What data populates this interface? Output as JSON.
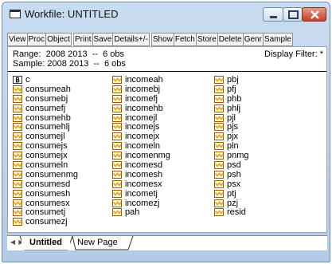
{
  "window": {
    "title": "Workfile: UNTITLED"
  },
  "toolbar": [
    "View",
    "Proc",
    "Object",
    "Print",
    "Save",
    "Details+/-",
    "Show",
    "Fetch",
    "Store",
    "Delete",
    "Genr",
    "Sample"
  ],
  "info": {
    "range": "Range:  2008 2013  --  6 obs",
    "sample": "Sample: 2008 2013  --  6 obs",
    "filter": "Display Filter: *"
  },
  "columns": [
    [
      "c",
      "consumeah",
      "consumebj",
      "consumefj",
      "consumehb",
      "consumehlj",
      "consumejl",
      "consumejs",
      "consumejx",
      "consumeln",
      "consumenmg",
      "consumesd",
      "consumesh",
      "consumesx",
      "consumetj",
      "consumezj"
    ],
    [
      "incomeah",
      "incomebj",
      "incomefj",
      "incomehb",
      "incomejl",
      "incomejs",
      "incomejx",
      "incomeln",
      "incomenmg",
      "incomesd",
      "incomesh",
      "incomesx",
      "incometj",
      "incomezj",
      "pah"
    ],
    [
      "pbj",
      "pfj",
      "phb",
      "phlj",
      "pjl",
      "pjs",
      "pjx",
      "pln",
      "pnmg",
      "psd",
      "psh",
      "psx",
      "ptj",
      "pzj",
      "resid"
    ]
  ],
  "tabs": {
    "active": "Untitled",
    "new_page": "New Page"
  },
  "colors": {
    "icon_orange": "#e8a317",
    "icon_border": "#9a5c00",
    "coef_bg": "#ffffff"
  },
  "icons": {
    "coef": "beta-coef-icon",
    "series": "series-icon"
  }
}
